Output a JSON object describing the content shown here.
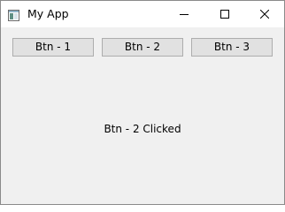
{
  "window": {
    "title": "My App",
    "icon": "app-window-icon",
    "controls": {
      "minimize_icon": "minimize-icon",
      "maximize_icon": "maximize-icon",
      "close_icon": "close-icon"
    }
  },
  "buttons": [
    {
      "label": "Btn - 1"
    },
    {
      "label": "Btn - 2"
    },
    {
      "label": "Btn - 3"
    }
  ],
  "status": {
    "text": "Btn - 2 Clicked"
  },
  "colors": {
    "titlebar": "#ffffff",
    "client_background": "#f0f0f0",
    "button_face": "#e1e1e1",
    "button_border": "#adadad"
  }
}
